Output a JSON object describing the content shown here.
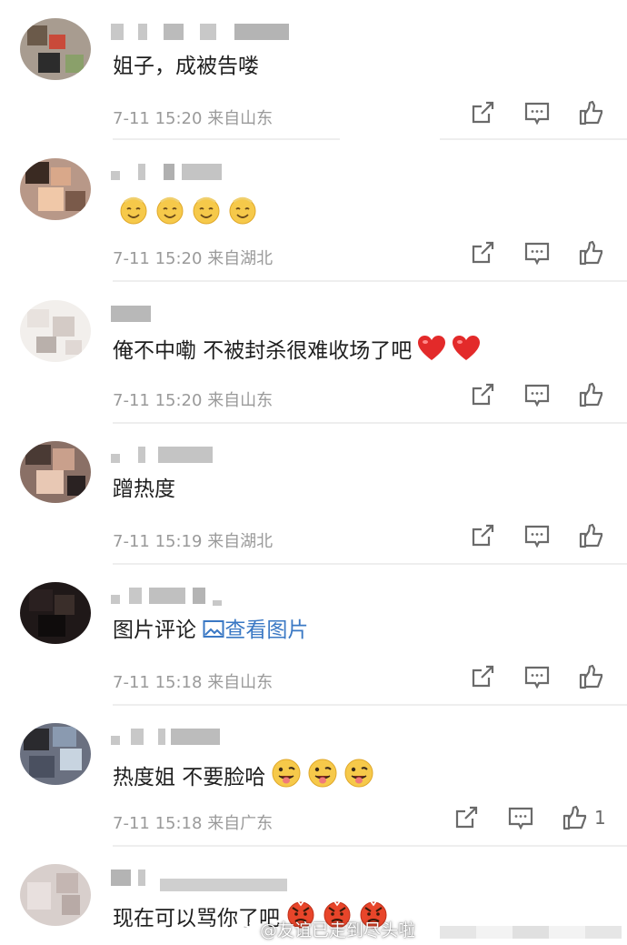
{
  "comments": [
    {
      "text": "姐子，成被告喽",
      "time": "7-11 15:20",
      "location": "来自山东",
      "avatar_colors": [
        "#6b5a4a",
        "#c94a3a",
        "#2c2c2c",
        "#8aa06a"
      ],
      "like_count": ""
    },
    {
      "text": "",
      "emojis": 4,
      "time": "7-11 15:20",
      "location": "来自湖北",
      "avatar_colors": [
        "#3a2a22",
        "#d9a88a",
        "#f0c8a8",
        "#7a5a4a"
      ],
      "like_count": ""
    },
    {
      "text": "俺不中嘞 不被封杀很难收场了吧",
      "hearts": 2,
      "time": "7-11 15:20",
      "location": "来自山东",
      "avatar_colors": [
        "#e8e2de",
        "#d4cbc6",
        "#b9b0ab",
        "#f2efec"
      ],
      "like_count": ""
    },
    {
      "text": "蹭热度",
      "time": "7-11 15:19",
      "location": "来自湖北",
      "avatar_colors": [
        "#4a3a34",
        "#c9a08c",
        "#e8c8b4",
        "#2a2222"
      ],
      "like_count": ""
    },
    {
      "text": "图片评论",
      "link_text": "查看图片",
      "time": "7-11 15:18",
      "location": "来自山东",
      "avatar_colors": [
        "#1a1414",
        "#2a2020",
        "#3a2e2a",
        "#0f0c0c"
      ],
      "like_count": ""
    },
    {
      "text": "热度姐 不要脸哈",
      "tongue_emojis": 3,
      "time": "7-11 15:18",
      "location": "来自广东",
      "avatar_colors": [
        "#2a2a2e",
        "#8a9ab0",
        "#c8d4e0",
        "#4a5060"
      ],
      "like_count": "1"
    },
    {
      "text": "现在可以骂你了吧",
      "angry_emojis": 3,
      "avatar_colors": [
        "#d8cfcc",
        "#c4b6b2",
        "#e8e0de",
        "#b8aaa6"
      ],
      "like_count": ""
    }
  ],
  "watermark": {
    "text": "@友谊已走到尽头啦"
  },
  "colors": {
    "meta": "#9a9a9a",
    "link": "#3a78c4",
    "icon": "#6a6a6a",
    "divider": "#eeeeee"
  }
}
